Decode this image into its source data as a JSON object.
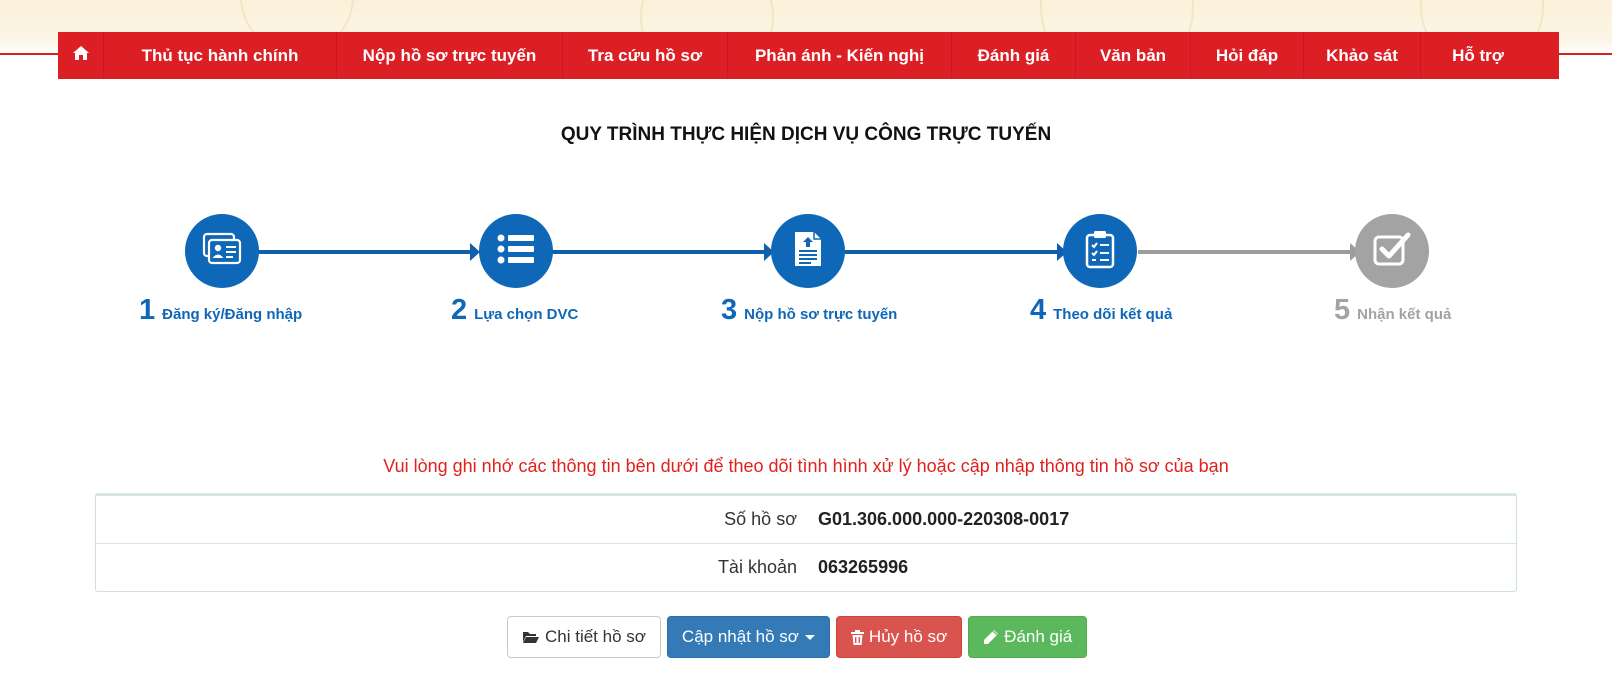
{
  "nav": {
    "home_icon": "home-icon",
    "items": [
      {
        "label": "Thủ tục hành chính"
      },
      {
        "label": "Nộp hồ sơ trực tuyến"
      },
      {
        "label": "Tra cứu hồ sơ"
      },
      {
        "label": "Phản ánh - Kiến nghị"
      },
      {
        "label": "Đánh giá"
      },
      {
        "label": "Văn bản"
      },
      {
        "label": "Hỏi đáp"
      },
      {
        "label": "Khảo sát"
      },
      {
        "label": "Hỗ trợ"
      }
    ]
  },
  "process": {
    "title": "QUY TRÌNH THỰC HIỆN DỊCH VỤ CÔNG TRỰC TUYẾN",
    "steps": [
      {
        "number": "1",
        "label": "Đăng ký/Đăng nhập",
        "icon": "id-card-icon",
        "status": "active"
      },
      {
        "number": "2",
        "label": "Lựa chọn DVC",
        "icon": "list-icon",
        "status": "active"
      },
      {
        "number": "3",
        "label": "Nộp hồ sơ trực tuyến",
        "icon": "document-upload-icon",
        "status": "active"
      },
      {
        "number": "4",
        "label": "Theo dõi kết quả",
        "icon": "clipboard-checklist-icon",
        "status": "active"
      },
      {
        "number": "5",
        "label": "Nhận kết quả",
        "icon": "check-square-icon",
        "status": "inactive"
      }
    ]
  },
  "notice": "Vui lòng ghi nhớ các thông tin bên dưới để theo dõi tình hình xử lý hoặc cập nhập thông tin hồ sơ của bạn",
  "record": {
    "rows": [
      {
        "label": "Số hồ sơ",
        "value": "G01.306.000.000-220308-0017"
      },
      {
        "label": "Tài khoản",
        "value": "063265996"
      }
    ]
  },
  "actions": {
    "detail_label": "Chi tiết hồ sơ",
    "update_label": "Cập nhật hồ sơ",
    "cancel_label": "Hủy hồ sơ",
    "rate_label": "Đánh giá"
  },
  "colors": {
    "nav_red": "#dc1f25",
    "step_active": "#0f67b8",
    "step_inactive": "#a3a3a3",
    "notice_red": "#e2201c"
  }
}
